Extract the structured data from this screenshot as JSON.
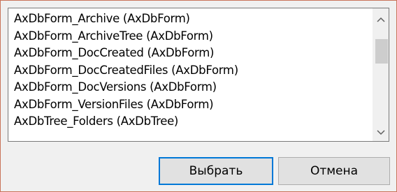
{
  "list": {
    "items": [
      "AxDbForm_Archive (AxDbForm)",
      "AxDbForm_ArchiveTree (AxDbForm)",
      "AxDbForm_DocCreated (AxDbForm)",
      "AxDbForm_DocCreatedFiles (AxDbForm)",
      "AxDbForm_DocVersions (AxDbForm)",
      "AxDbForm_VersionFiles (AxDbForm)",
      "AxDbTree_Folders (AxDbTree)"
    ],
    "scroll_up_icon": "chevron-up-icon",
    "scroll_down_icon": "chevron-down-icon"
  },
  "buttons": {
    "ok_label": "Выбрать",
    "cancel_label": "Отмена"
  },
  "colors": {
    "window_border": "#c9735a",
    "default_button_border": "#0078d7",
    "dialog_background": "#f0f0f0"
  }
}
